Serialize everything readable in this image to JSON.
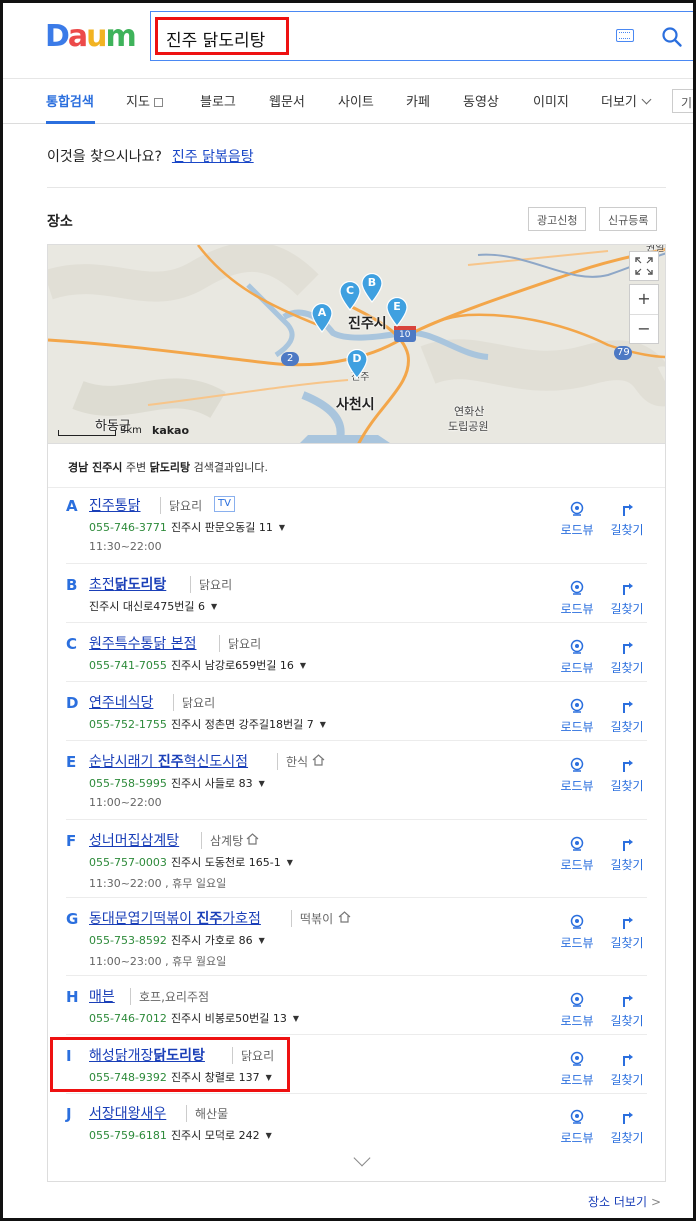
{
  "logo": {
    "text": "Daum"
  },
  "search": {
    "query": "진주 닭도리탕"
  },
  "tabs": [
    {
      "label": "통합검색"
    },
    {
      "label": "지도"
    },
    {
      "label": "블로그"
    },
    {
      "label": "웹문서"
    },
    {
      "label": "사이트"
    },
    {
      "label": "카페"
    },
    {
      "label": "동영상"
    },
    {
      "label": "이미지"
    },
    {
      "label": "더보기"
    },
    {
      "label": "기"
    }
  ],
  "suggestion": {
    "prefix": "이것을 찾으시나요?",
    "link": "진주 닭볶음탕"
  },
  "places": {
    "title": "장소",
    "ad_button": "광고신청",
    "register_button": "신규등록",
    "more_link": "장소 더보기",
    "note_region": "경남 진주시",
    "note_mid": " 주변 ",
    "note_query": "닭도리탕",
    "note_suffix": " 검색결과입니다."
  },
  "map": {
    "scale": "3km",
    "brand": "kakao",
    "labels": {
      "jinju": "진주시",
      "sacheon": "사천시",
      "hadong": "하동군",
      "yeonhwasan1": "연화산",
      "yeonhwasan2": "도립공원",
      "jinju_small": "진주",
      "route_2": "2",
      "route_10": "10",
      "route_79": "79",
      "top_right": "권일"
    },
    "pins": [
      "A",
      "B",
      "C",
      "D",
      "E"
    ]
  },
  "actions": {
    "roadview": "로드뷰",
    "route": "길찾기"
  },
  "results": [
    {
      "letter": "A",
      "name_pre": "진주통닭",
      "name_bold": "",
      "name_post": "",
      "category": "닭요리",
      "tv": "TV",
      "home": false,
      "phone": "055-746-3771",
      "address": "진주시 판문오동길 11",
      "hours": "11:30~22:00"
    },
    {
      "letter": "B",
      "name_pre": "초전",
      "name_bold": "닭도리탕",
      "name_post": "",
      "category": "닭요리",
      "tv": "",
      "home": false,
      "phone": "",
      "address": "진주시 대신로475번길 6",
      "hours": ""
    },
    {
      "letter": "C",
      "name_pre": "원주특수통닭 본점",
      "name_bold": "",
      "name_post": "",
      "category": "닭요리",
      "tv": "",
      "home": false,
      "phone": "055-741-7055",
      "address": "진주시 남강로659번길 16",
      "hours": ""
    },
    {
      "letter": "D",
      "name_pre": "연주네식당",
      "name_bold": "",
      "name_post": "",
      "category": "닭요리",
      "tv": "",
      "home": false,
      "phone": "055-752-1755",
      "address": "진주시 정촌면 강주길18번길 7",
      "hours": ""
    },
    {
      "letter": "E",
      "name_pre": "순남시래기 ",
      "name_bold": "진주",
      "name_post": "혁신도시점",
      "category": "한식",
      "tv": "",
      "home": true,
      "phone": "055-758-5995",
      "address": "진주시 사들로 83",
      "hours": "11:00~22:00"
    },
    {
      "letter": "F",
      "name_pre": "성너머집삼계탕",
      "name_bold": "",
      "name_post": "",
      "category": "삼계탕",
      "tv": "",
      "home": true,
      "phone": "055-757-0003",
      "address": "진주시 도동천로 165-1",
      "hours": "11:30~22:00 , 휴무 일요일"
    },
    {
      "letter": "G",
      "name_pre": "동대문엽기떡볶이 ",
      "name_bold": "진주",
      "name_post": "가호점",
      "category": "떡볶이",
      "tv": "",
      "home": true,
      "phone": "055-753-8592",
      "address": "진주시 가호로 86",
      "hours": "11:00~23:00 , 휴무 월요일"
    },
    {
      "letter": "H",
      "name_pre": "매븐",
      "name_bold": "",
      "name_post": "",
      "category": "호프,요리주점",
      "tv": "",
      "home": false,
      "phone": "055-746-7012",
      "address": "진주시 비봉로50번길 13",
      "hours": ""
    },
    {
      "letter": "I",
      "name_pre": "해성닭개장",
      "name_bold": "닭도리탕",
      "name_post": "",
      "category": "닭요리",
      "tv": "",
      "home": false,
      "phone": "055-748-9392",
      "address": "진주시 창렬로 137",
      "hours": ""
    },
    {
      "letter": "J",
      "name_pre": "서장대왕새우",
      "name_bold": "",
      "name_post": "",
      "category": "해산물",
      "tv": "",
      "home": false,
      "phone": "055-759-6181",
      "address": "진주시 모덕로 242",
      "hours": ""
    }
  ]
}
